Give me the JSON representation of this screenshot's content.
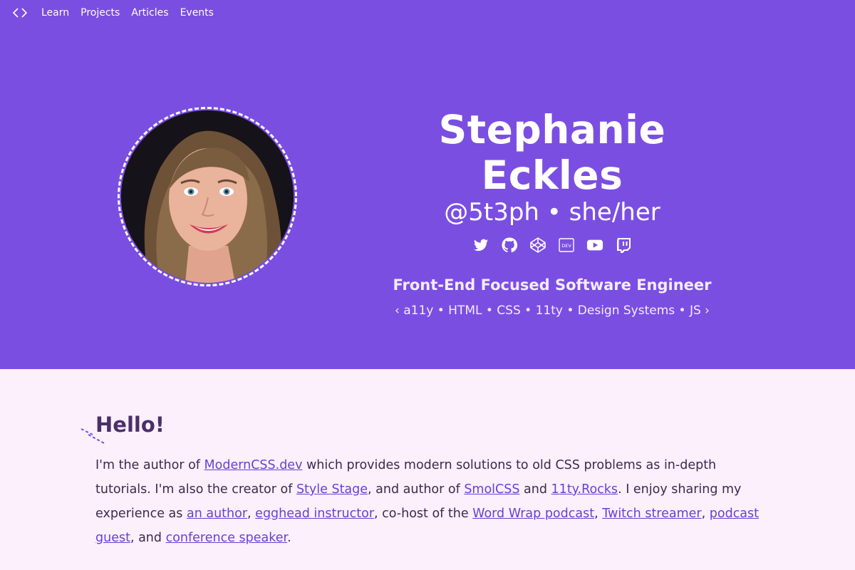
{
  "nav": {
    "logo_icon": "code-brackets-icon",
    "items": [
      {
        "label": "Learn"
      },
      {
        "label": "Projects"
      },
      {
        "label": "Articles"
      },
      {
        "label": "Events"
      }
    ]
  },
  "profile": {
    "name": "Stephanie Eckles",
    "handle": "@5t3ph • she/her",
    "social_icons": [
      "twitter-icon",
      "github-icon",
      "codepen-icon",
      "dev-icon",
      "youtube-icon",
      "twitch-icon"
    ],
    "role": "Front-End Focused Software Engineer",
    "tags": "‹ a11y • HTML • CSS • 11ty • Design Systems • JS ›"
  },
  "content": {
    "heading": "Hello!",
    "bio": {
      "t1": "I'm the author of ",
      "link_moderncss": "ModernCSS.dev",
      "t2": " which provides modern solutions to old CSS problems as in-depth tutorials. I'm also the creator of ",
      "link_stylestage": "Style Stage",
      "t3": ", and author of ",
      "link_smolcss": "SmolCSS",
      "t4": " and ",
      "link_11tyrocks": "11ty.Rocks",
      "t5": ". I enjoy sharing my experience as ",
      "link_author": "an author",
      "t6": ", ",
      "link_egghead": "egghead instructor",
      "t7": ", co-host of the ",
      "link_wordwrap": "Word Wrap podcast",
      "t8": ", ",
      "link_twitch": "Twitch streamer",
      "t9": ", ",
      "link_podcast": "podcast guest",
      "t10": ", and ",
      "link_speaker": "conference speaker",
      "t11": "."
    }
  },
  "colors": {
    "hero_bg": "#7b4ee2",
    "page_bg": "#fbf0fc",
    "link": "#6a3fd4",
    "heading": "#4b2f6a"
  }
}
